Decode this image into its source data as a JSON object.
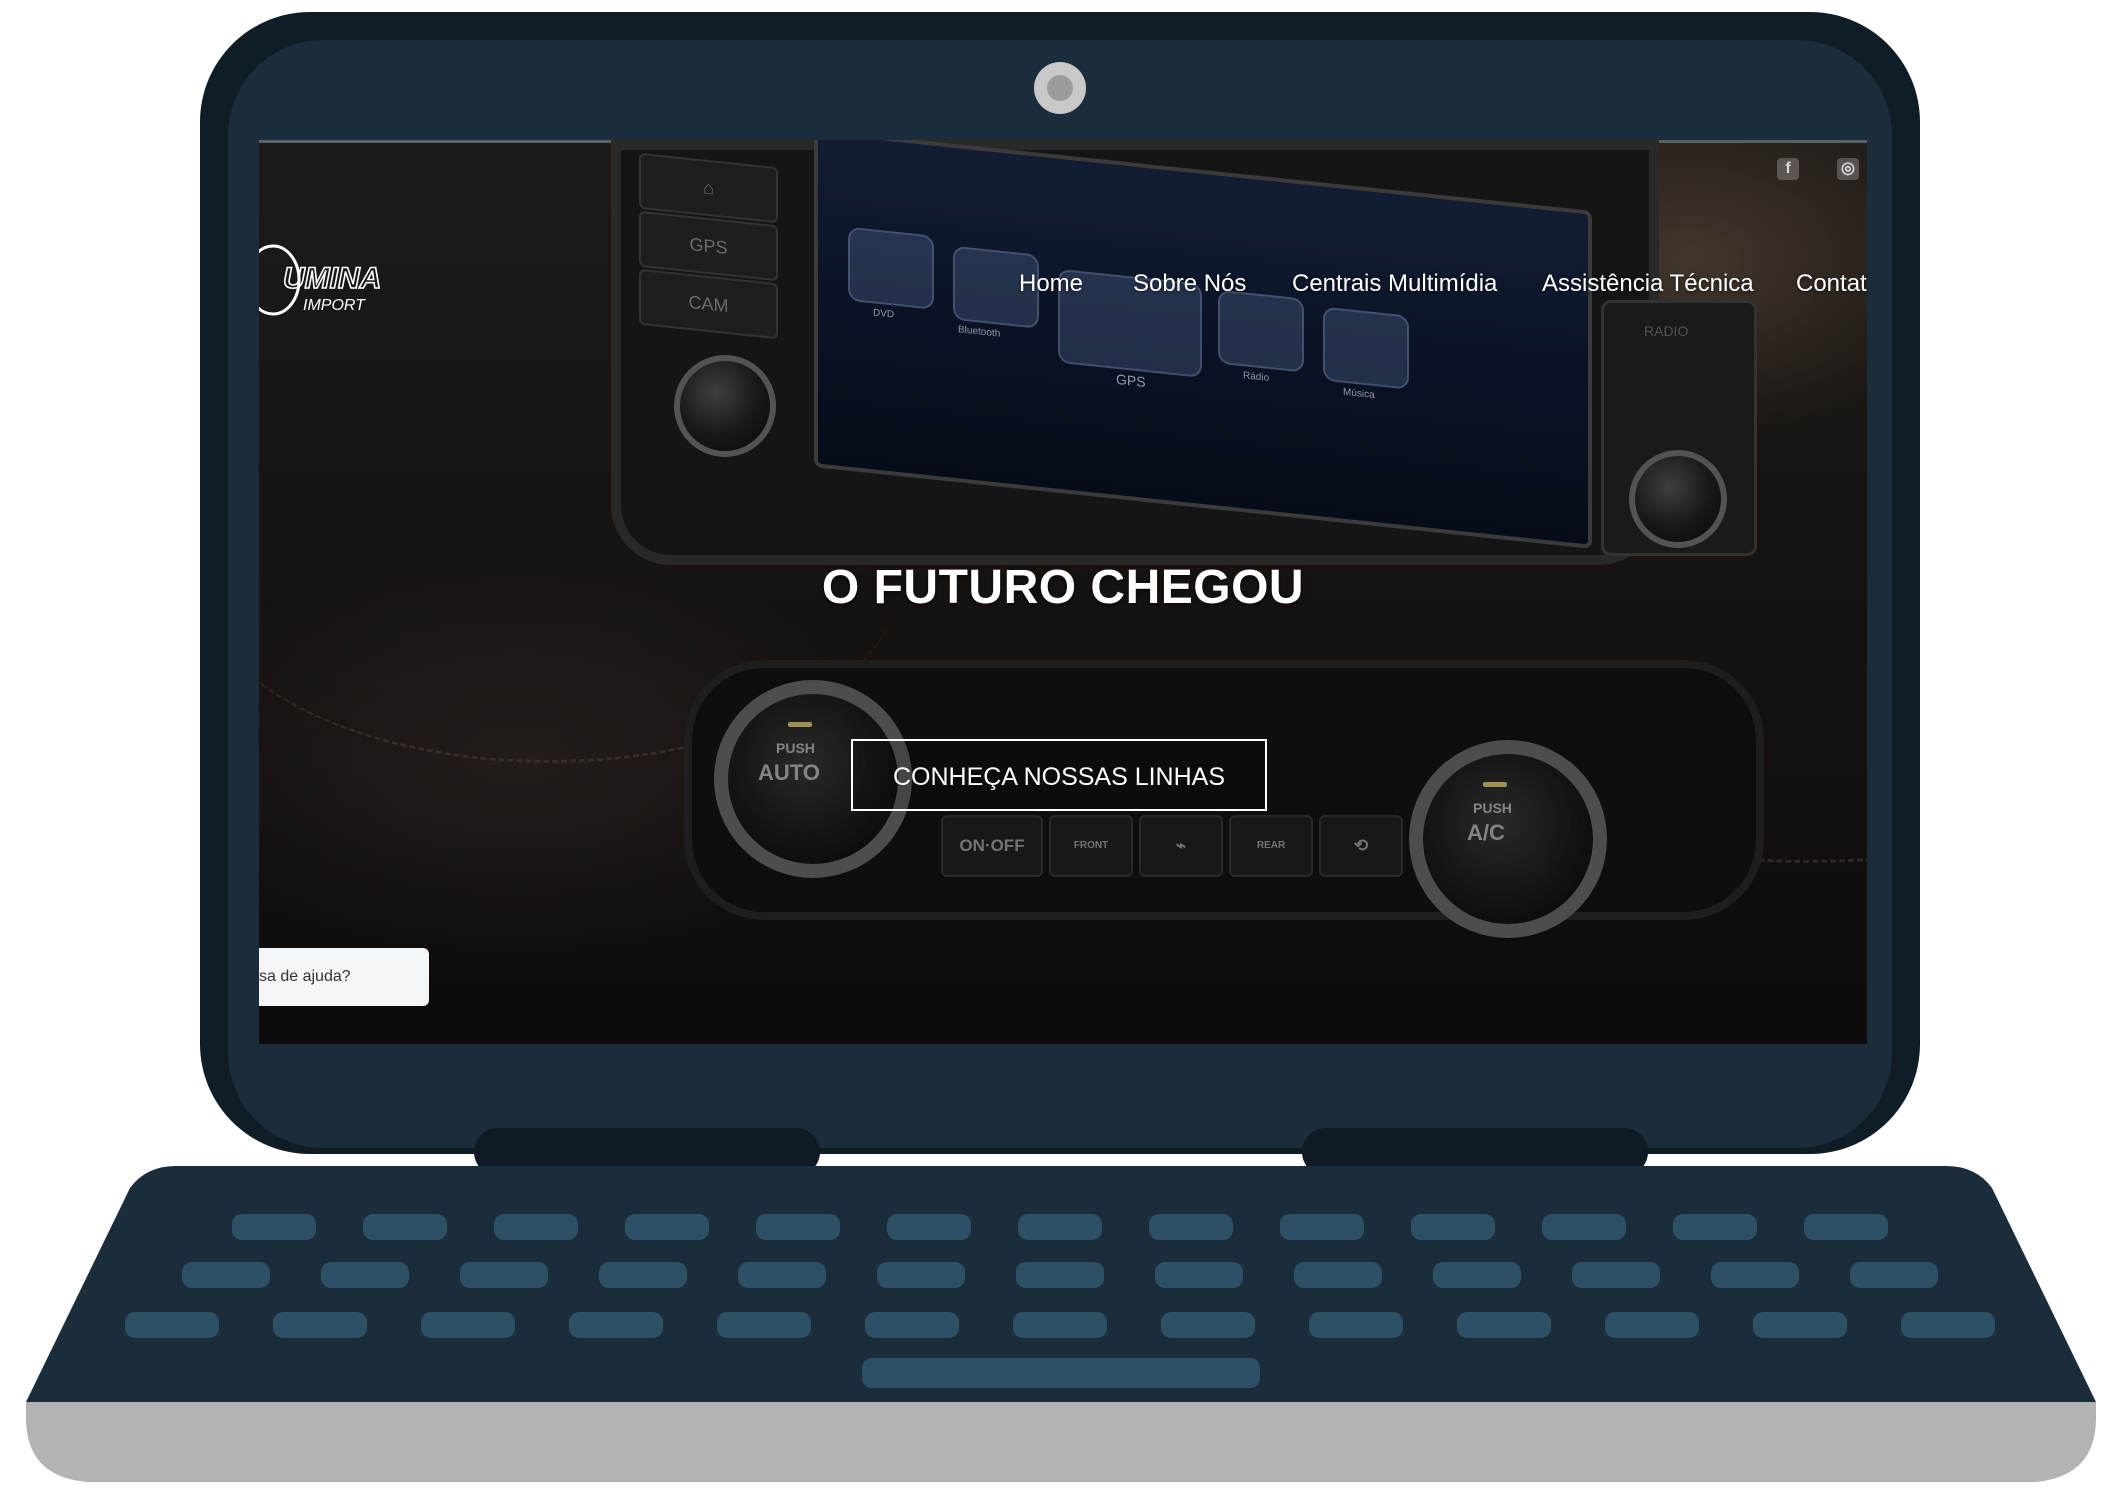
{
  "site": {
    "logo": {
      "text": "UMINA",
      "subtext": "IMPORT"
    },
    "nav": [
      {
        "label": "Home"
      },
      {
        "label": "Sobre Nós"
      },
      {
        "label": "Centrais Multimídia"
      },
      {
        "label": "Assistência Técnica"
      },
      {
        "label": "Contat"
      }
    ],
    "social": [
      {
        "name": "facebook-icon",
        "glyph": "f"
      },
      {
        "name": "instagram-icon",
        "glyph": "◎"
      }
    ],
    "hero": {
      "title": "O FUTURO CHEGOU",
      "cta_label": "CONHEÇA NOSSAS LINHAS"
    },
    "help_widget": {
      "label": "sa de ajuda?"
    }
  },
  "scene": {
    "console_buttons": [
      "GPS",
      "CAM"
    ],
    "apps": [
      "DVD",
      "Bluetooth",
      "GPS",
      "Rádio",
      "Música"
    ],
    "side_buttons": [
      "RADIO"
    ],
    "knob_left": {
      "top": "PUSH",
      "bottom": "AUTO"
    },
    "knob_right": {
      "top": "PUSH",
      "bottom": "A/C"
    },
    "hvac_buttons": [
      "ON·OFF",
      "FRONT",
      "",
      "REAR",
      ""
    ]
  },
  "colors": {
    "laptop_outer": "#0f1d26",
    "laptop_bezel": "#1b2c3a",
    "keys": "#2e5064",
    "base_bottom": "#b3b3b3"
  }
}
